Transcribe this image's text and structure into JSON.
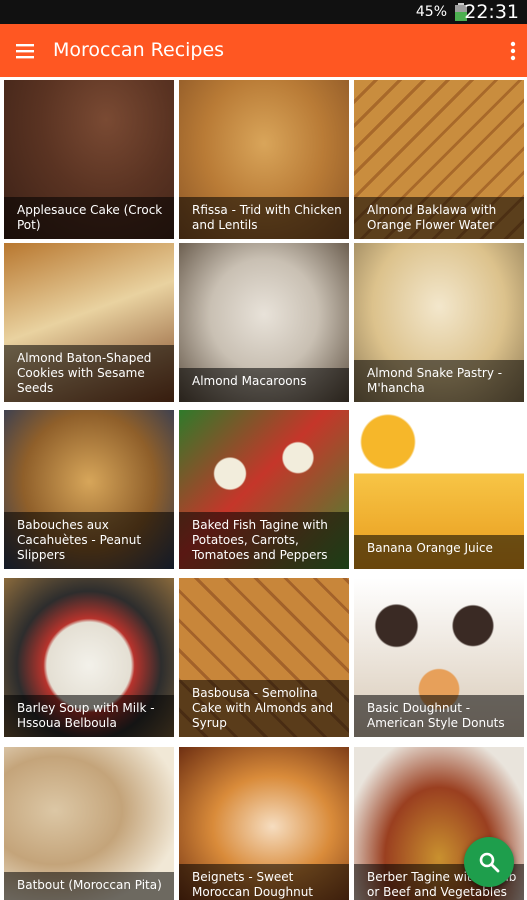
{
  "status_bar": {
    "battery": "45%",
    "time": "22:31"
  },
  "app_bar": {
    "title": "Moroccan Recipes"
  },
  "recipes": [
    "Applesauce Cake (Crock Pot)",
    "Rfissa - Trid with Chicken and Lentils",
    "Almond Baklawa with Orange Flower Water",
    "Almond Baton-Shaped Cookies with Sesame Seeds",
    "Almond Macaroons",
    "Almond Snake Pastry - M'hancha",
    "Babouches aux Cacahuètes - Peanut Slippers",
    "Baked Fish Tagine with Potatoes, Carrots, Tomatoes and Peppers",
    "Banana Orange Juice",
    "Barley Soup with Milk - Hssoua Belboula",
    "Basbousa - Semolina Cake with Almonds and Syrup",
    "Basic Doughnut - American Style Donuts",
    "Batbout (Moroccan Pita)",
    "Beignets - Sweet Moroccan Doughnut",
    "Berber Tagine with Lamb or Beef and Vegetables"
  ],
  "colors": {
    "app_bar": "#ff5722",
    "fab": "#1e9e4c",
    "status_bar": "#111111"
  },
  "icons": {
    "menu": "hamburger-icon",
    "overflow": "more-vert-icon",
    "fab": "search-icon"
  }
}
